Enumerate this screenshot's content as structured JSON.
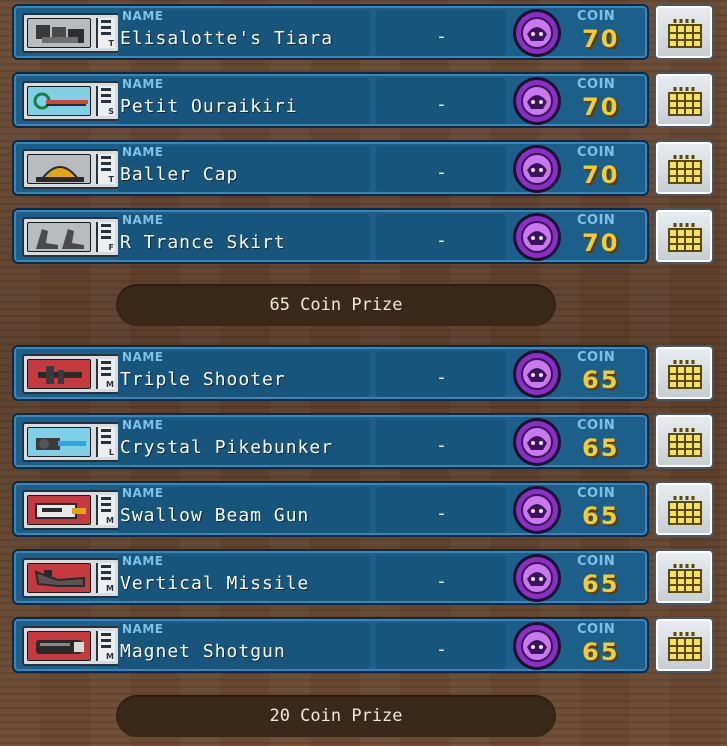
{
  "labels": {
    "name": "NAME",
    "coin": "COIN"
  },
  "sections": [
    {
      "items": [
        {
          "name": "Elisalotte's Tiara",
          "slot": "T",
          "extra": "-",
          "coin": "70",
          "art": "gray",
          "icon": "tiara-icon"
        },
        {
          "name": "Petit Ouraikiri",
          "slot": "S",
          "extra": "-",
          "coin": "70",
          "art": "cyan",
          "icon": "sword-icon"
        },
        {
          "name": "Baller Cap",
          "slot": "T",
          "extra": "-",
          "coin": "70",
          "art": "gray",
          "icon": "cap-icon"
        },
        {
          "name": "R Trance Skirt",
          "slot": "F",
          "extra": "-",
          "coin": "70",
          "art": "gray",
          "icon": "boots-icon"
        }
      ],
      "prize": "65 Coin Prize"
    },
    {
      "items": [
        {
          "name": "Triple Shooter",
          "slot": "M",
          "extra": "-",
          "coin": "65",
          "art": "red",
          "icon": "gun-icon"
        },
        {
          "name": "Crystal Pikebunker",
          "slot": "L",
          "extra": "-",
          "coin": "65",
          "art": "cyan",
          "icon": "pikebunker-icon"
        },
        {
          "name": "Swallow Beam Gun",
          "slot": "M",
          "extra": "-",
          "coin": "65",
          "art": "red",
          "icon": "beam-gun-icon"
        },
        {
          "name": "Vertical Missile",
          "slot": "M",
          "extra": "-",
          "coin": "65",
          "art": "red",
          "icon": "missile-icon"
        },
        {
          "name": "Magnet Shotgun",
          "slot": "M",
          "extra": "-",
          "coin": "65",
          "art": "red",
          "icon": "shotgun-icon"
        }
      ],
      "prize": "20 Coin Prize"
    }
  ],
  "colors": {
    "panel": "#1c5f8a",
    "coin_value": "#f3cd2a",
    "coin_purple": "#8a2fc2"
  }
}
